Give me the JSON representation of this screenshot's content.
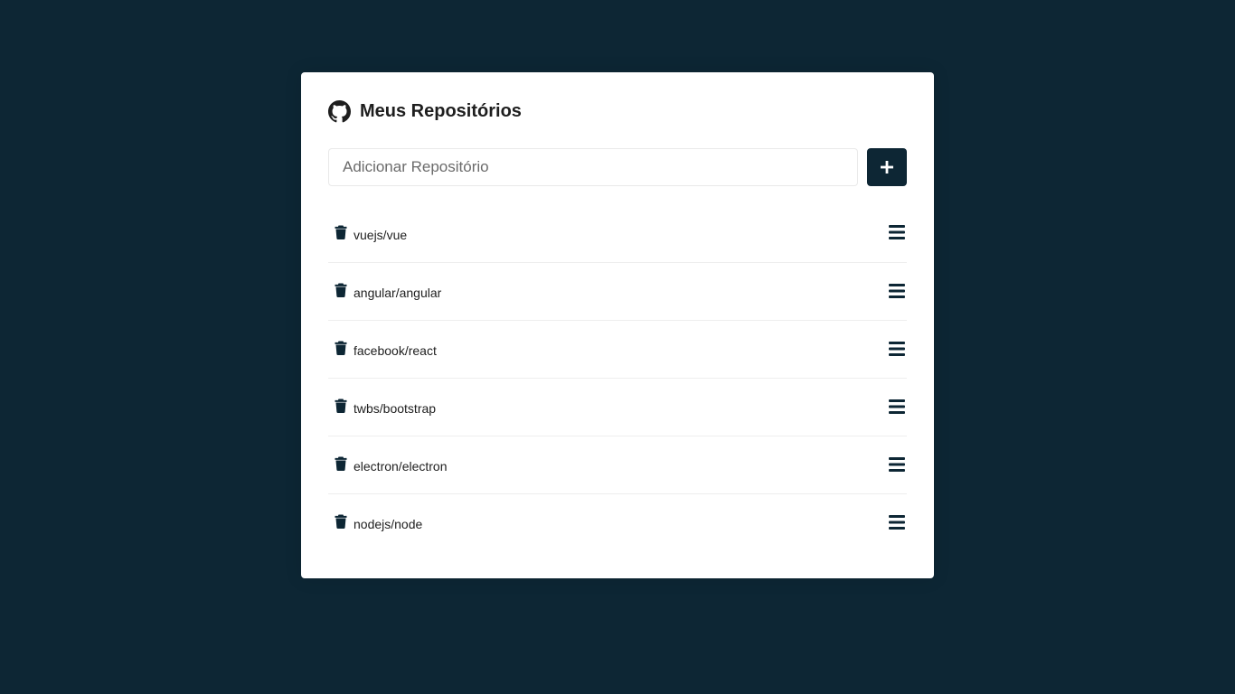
{
  "header": {
    "title": "Meus Repositórios",
    "icon": "github-icon"
  },
  "form": {
    "input_placeholder": "Adicionar Repositório",
    "input_value": "",
    "add_button_icon": "plus-icon"
  },
  "repositories": [
    {
      "name": "vuejs/vue"
    },
    {
      "name": "angular/angular"
    },
    {
      "name": "facebook/react"
    },
    {
      "name": "twbs/bootstrap"
    },
    {
      "name": "electron/electron"
    },
    {
      "name": "nodejs/node"
    }
  ],
  "item_icons": {
    "delete": "trash-icon",
    "details": "menu-icon"
  },
  "colors": {
    "background": "#0d2634",
    "card": "#ffffff",
    "accent": "#0d2634",
    "text": "#1e1e1e"
  }
}
